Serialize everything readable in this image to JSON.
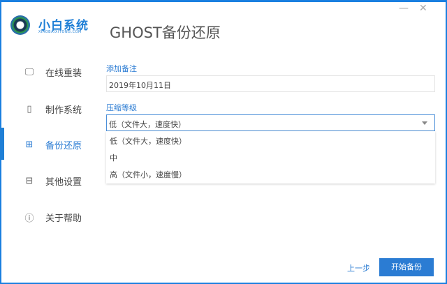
{
  "app": {
    "brand": "小白系统",
    "brand_sub": "XIAOBAIXITONG.COM",
    "page_title": "GHOST备份还原",
    "minimize": "—",
    "close": "✕"
  },
  "sidebar": {
    "items": [
      {
        "label": "在线重装",
        "icon": "monitor-icon",
        "glyph": "🖵"
      },
      {
        "label": "制作系统",
        "icon": "usb-icon",
        "glyph": "▯"
      },
      {
        "label": "备份还原",
        "icon": "backup-icon",
        "glyph": "⊞",
        "active": true
      },
      {
        "label": "其他设置",
        "icon": "briefcase-icon",
        "glyph": "⊟"
      },
      {
        "label": "关于帮助",
        "icon": "info-icon",
        "glyph": "ⓘ"
      }
    ]
  },
  "form": {
    "note_label": "添加备注",
    "note_value": "2019年10月11日",
    "compression_label": "压缩等级",
    "compression_value": "低（文件大，速度快）",
    "options": [
      "低（文件大，速度快）",
      "中",
      "高（文件小，速度慢）"
    ]
  },
  "footer": {
    "prev": "上一步",
    "start": "开始备份"
  },
  "colors": {
    "accent": "#2b7cd3",
    "border": "#1a7fe0"
  }
}
